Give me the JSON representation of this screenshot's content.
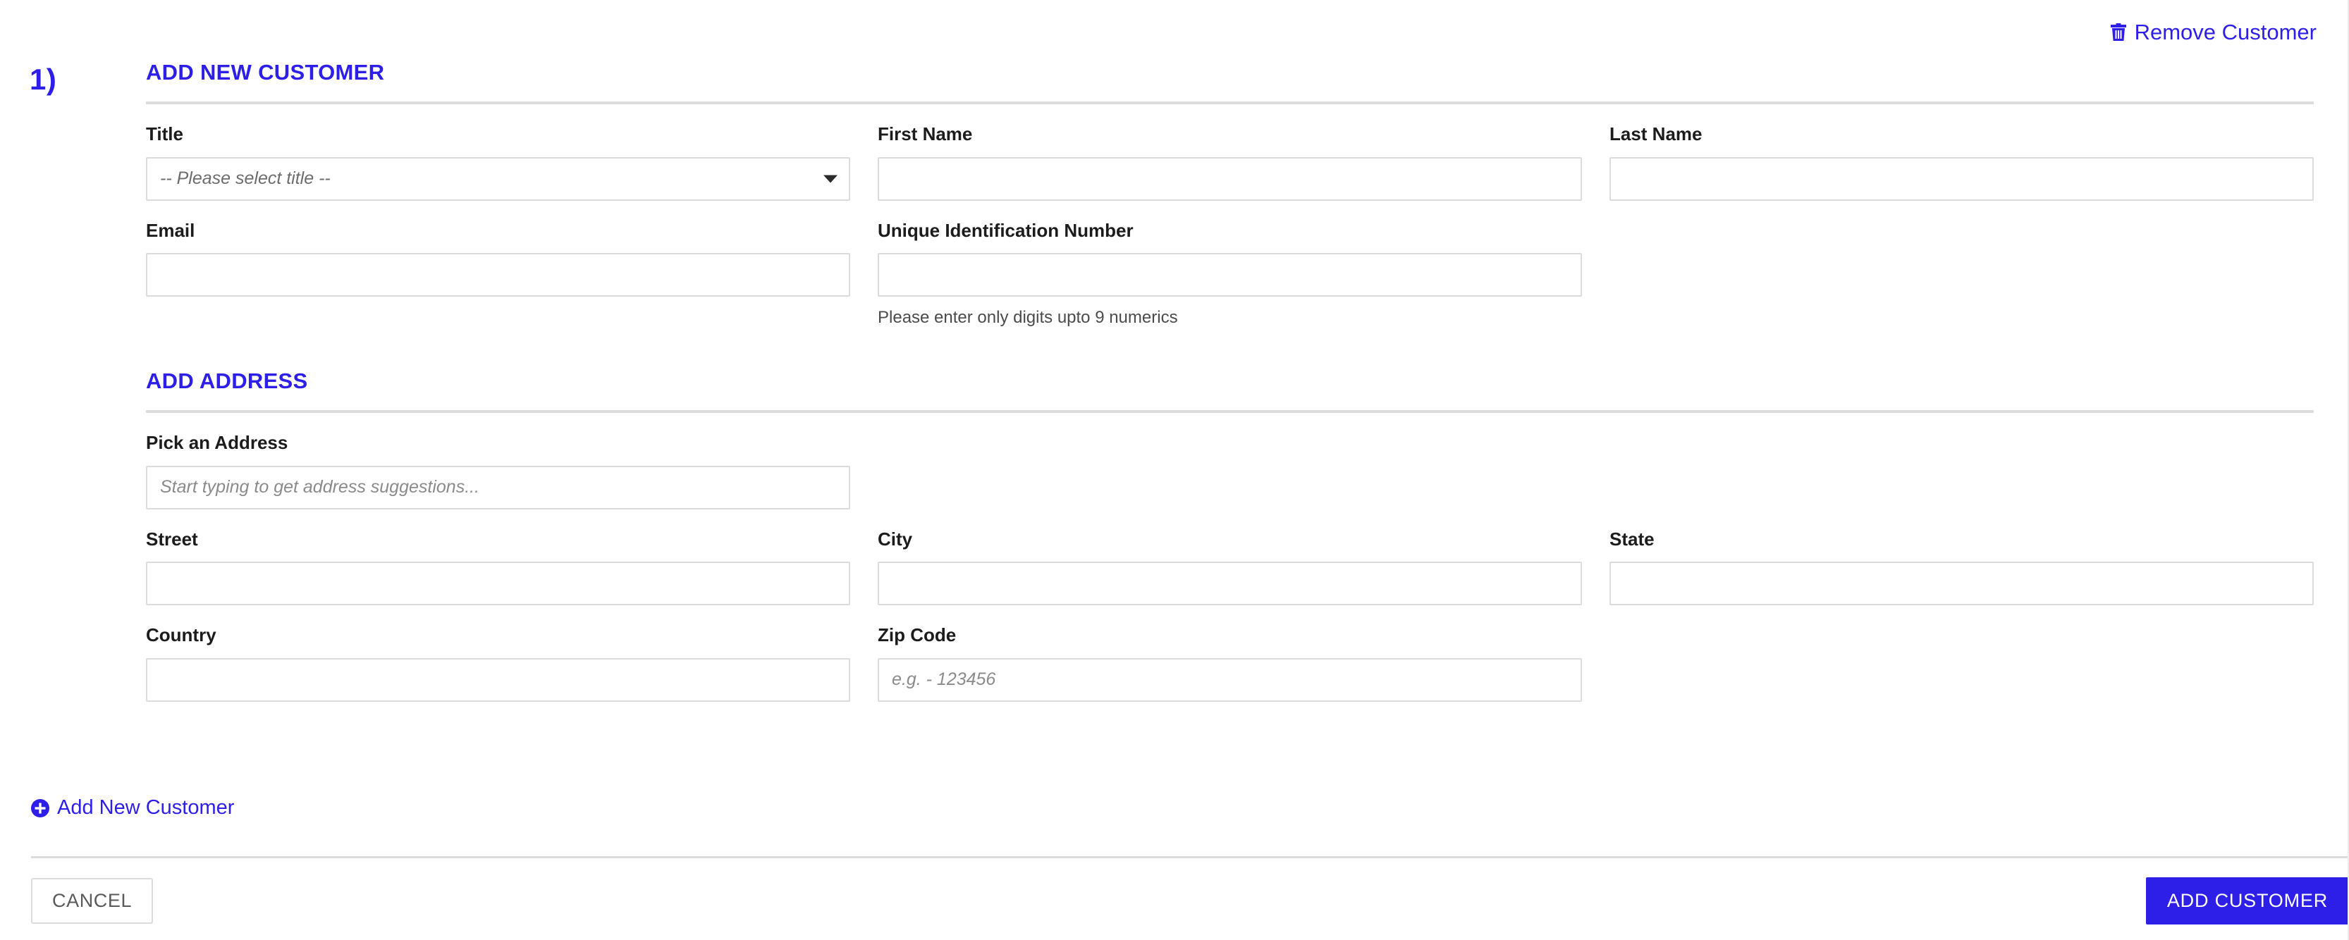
{
  "theme": {
    "accent": "#2d1fe8",
    "border": "#dcdcdc",
    "label_color": "#1c1c1c",
    "placeholder_color": "#8b8b8b"
  },
  "header": {
    "remove_customer_label": "Remove Customer",
    "remove_customer_icon": "trash-icon",
    "step_number": "1)"
  },
  "customer_section": {
    "title": "ADD NEW CUSTOMER",
    "fields": {
      "title": {
        "label": "Title",
        "selected": "-- Please select title --",
        "icon": "chevron-down-icon"
      },
      "first_name": {
        "label": "First Name",
        "value": "",
        "placeholder": ""
      },
      "last_name": {
        "label": "Last Name",
        "value": "",
        "placeholder": ""
      },
      "email": {
        "label": "Email",
        "value": "",
        "placeholder": ""
      },
      "uid": {
        "label": "Unique Identification Number",
        "value": "",
        "placeholder": "",
        "help": "Please enter only digits upto 9 numerics"
      }
    }
  },
  "address_section": {
    "title": "ADD ADDRESS",
    "fields": {
      "pick_address": {
        "label": "Pick an Address",
        "value": "",
        "placeholder": "Start typing to get address suggestions..."
      },
      "street": {
        "label": "Street",
        "value": "",
        "placeholder": ""
      },
      "city": {
        "label": "City",
        "value": "",
        "placeholder": ""
      },
      "state": {
        "label": "State",
        "value": "",
        "placeholder": ""
      },
      "country": {
        "label": "Country",
        "value": "",
        "placeholder": ""
      },
      "zip": {
        "label": "Zip Code",
        "value": "",
        "placeholder": "e.g. - 123456"
      }
    }
  },
  "actions": {
    "add_new_customer_label": "Add New Customer",
    "add_new_customer_icon": "plus-circle-icon",
    "cancel_label": "CANCEL",
    "submit_label": "ADD CUSTOMER"
  }
}
